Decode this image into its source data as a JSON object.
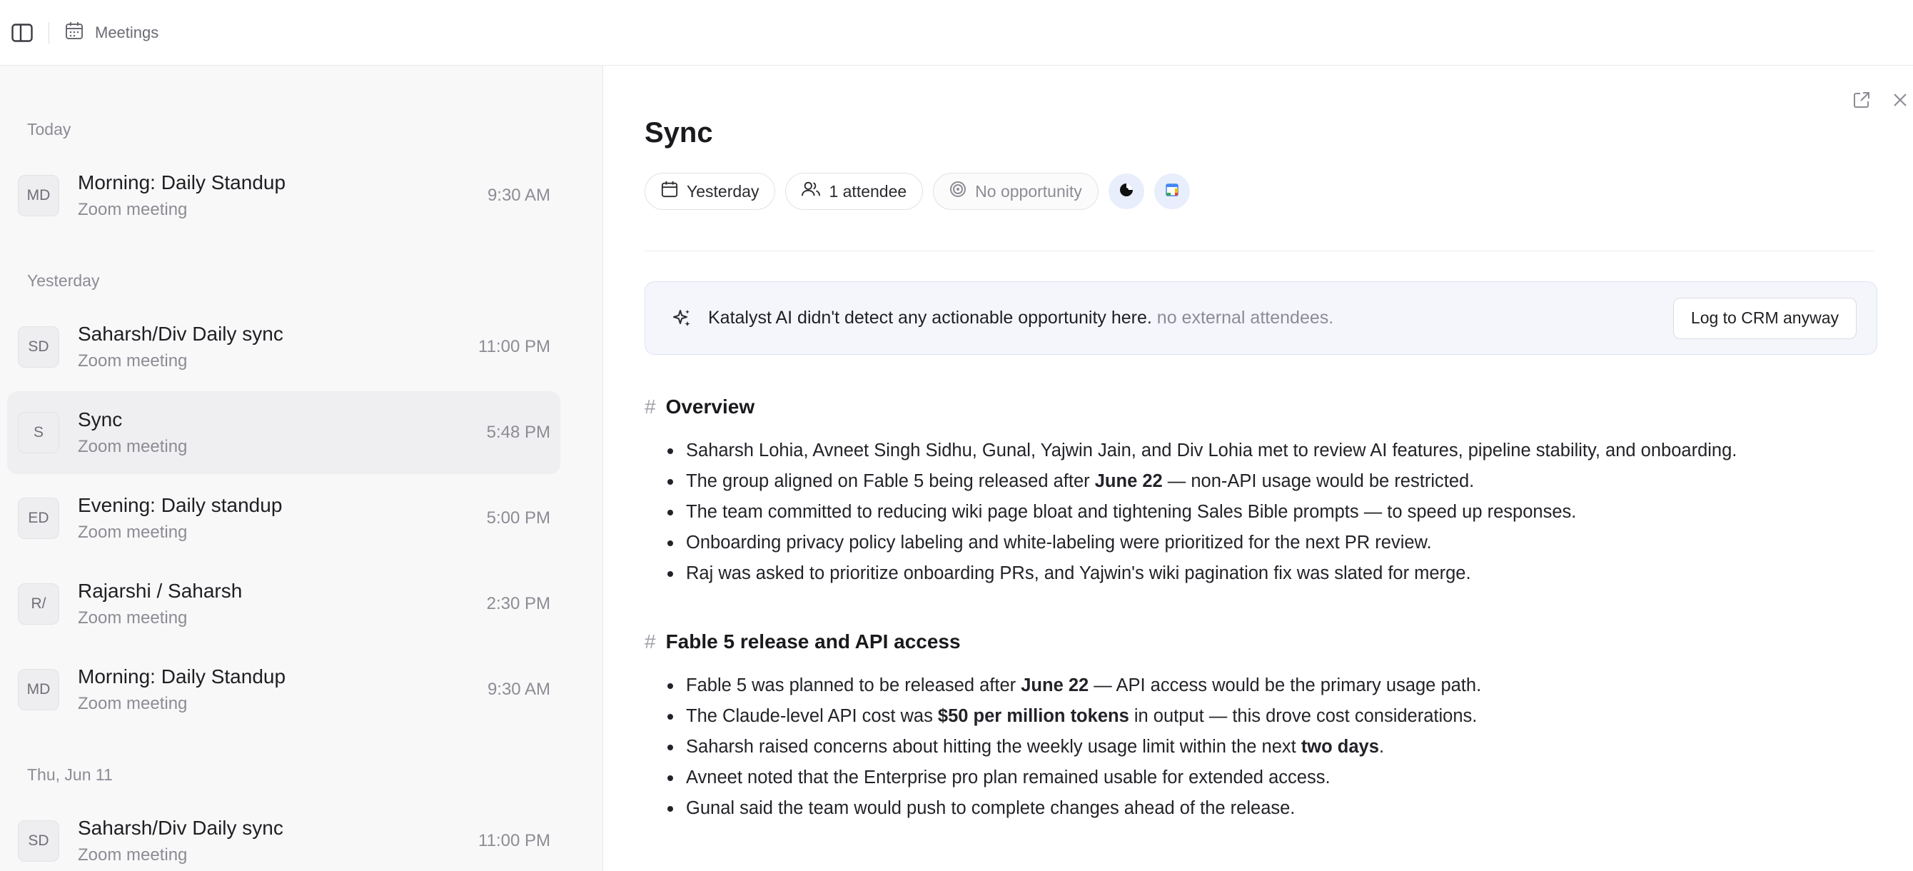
{
  "topbar": {
    "breadcrumb": "Meetings",
    "icons": {
      "toggle": "sidebar-toggle-icon",
      "crumb": "calendar-icon"
    }
  },
  "sidebar": {
    "groups": [
      {
        "label": "Today"
      },
      {
        "label": "Yesterday"
      },
      {
        "label": "Thu, Jun 11"
      }
    ],
    "meetings": [
      {
        "initials": "MD",
        "title": "Morning: Daily Standup",
        "subtitle": "Zoom meeting",
        "time": "9:30 AM",
        "selected": false
      },
      {
        "initials": "SD",
        "title": "Saharsh/Div Daily sync",
        "subtitle": "Zoom meeting",
        "time": "11:00 PM",
        "selected": false
      },
      {
        "initials": "S",
        "title": "Sync",
        "subtitle": "Zoom meeting",
        "time": "5:48 PM",
        "selected": true
      },
      {
        "initials": "ED",
        "title": "Evening: Daily standup",
        "subtitle": "Zoom meeting",
        "time": "5:00 PM",
        "selected": false
      },
      {
        "initials": "R/",
        "title": "Rajarshi / Saharsh",
        "subtitle": "Zoom meeting",
        "time": "2:30 PM",
        "selected": false
      },
      {
        "initials": "MD",
        "title": "Morning: Daily Standup",
        "subtitle": "Zoom meeting",
        "time": "9:30 AM",
        "selected": false
      },
      {
        "initials": "SD",
        "title": "Saharsh/Div Daily sync",
        "subtitle": "Zoom meeting",
        "time": "11:00 PM",
        "selected": false
      }
    ]
  },
  "detail": {
    "title": "Sync",
    "chips": {
      "date": "Yesterday",
      "attendees": "1 attendee",
      "opportunity": "No opportunity"
    },
    "banner": {
      "message": "Katalyst AI didn't detect any actionable opportunity here.",
      "reason": "no external attendees.",
      "button": "Log to CRM anyway"
    },
    "sections": [
      {
        "heading": "Overview",
        "bullets": [
          [
            {
              "t": "Saharsh Lohia, Avneet Singh Sidhu, Gunal, Yajwin Jain, and Div Lohia met to review AI features, pipeline stability, and onboarding."
            }
          ],
          [
            {
              "t": "The group aligned on Fable 5 being released after "
            },
            {
              "t": "June 22",
              "b": true
            },
            {
              "t": " — non-API usage would be restricted."
            }
          ],
          [
            {
              "t": "The team committed to reducing wiki page bloat and tightening Sales Bible prompts — to speed up responses."
            }
          ],
          [
            {
              "t": "Onboarding privacy policy labeling and white-labeling were prioritized for the next PR review."
            }
          ],
          [
            {
              "t": "Raj was asked to prioritize onboarding PRs, and Yajwin's wiki pagination fix was slated for merge."
            }
          ]
        ]
      },
      {
        "heading": "Fable 5 release and API access",
        "bullets": [
          [
            {
              "t": "Fable 5 was planned to be released after "
            },
            {
              "t": "June 22",
              "b": true
            },
            {
              "t": " — API access would be the primary usage path."
            }
          ],
          [
            {
              "t": "The Claude-level API cost was "
            },
            {
              "t": "$50 per million tokens",
              "b": true
            },
            {
              "t": " in output — this drove cost considerations."
            }
          ],
          [
            {
              "t": "Saharsh raised concerns about hitting the weekly usage limit within the next "
            },
            {
              "t": "two days",
              "b": true
            },
            {
              "t": "."
            }
          ],
          [
            {
              "t": "Avneet noted that the Enterprise pro plan remained usable for extended access."
            }
          ],
          [
            {
              "t": "Gunal said the team would push to complete changes ahead of the release."
            }
          ]
        ]
      }
    ]
  }
}
